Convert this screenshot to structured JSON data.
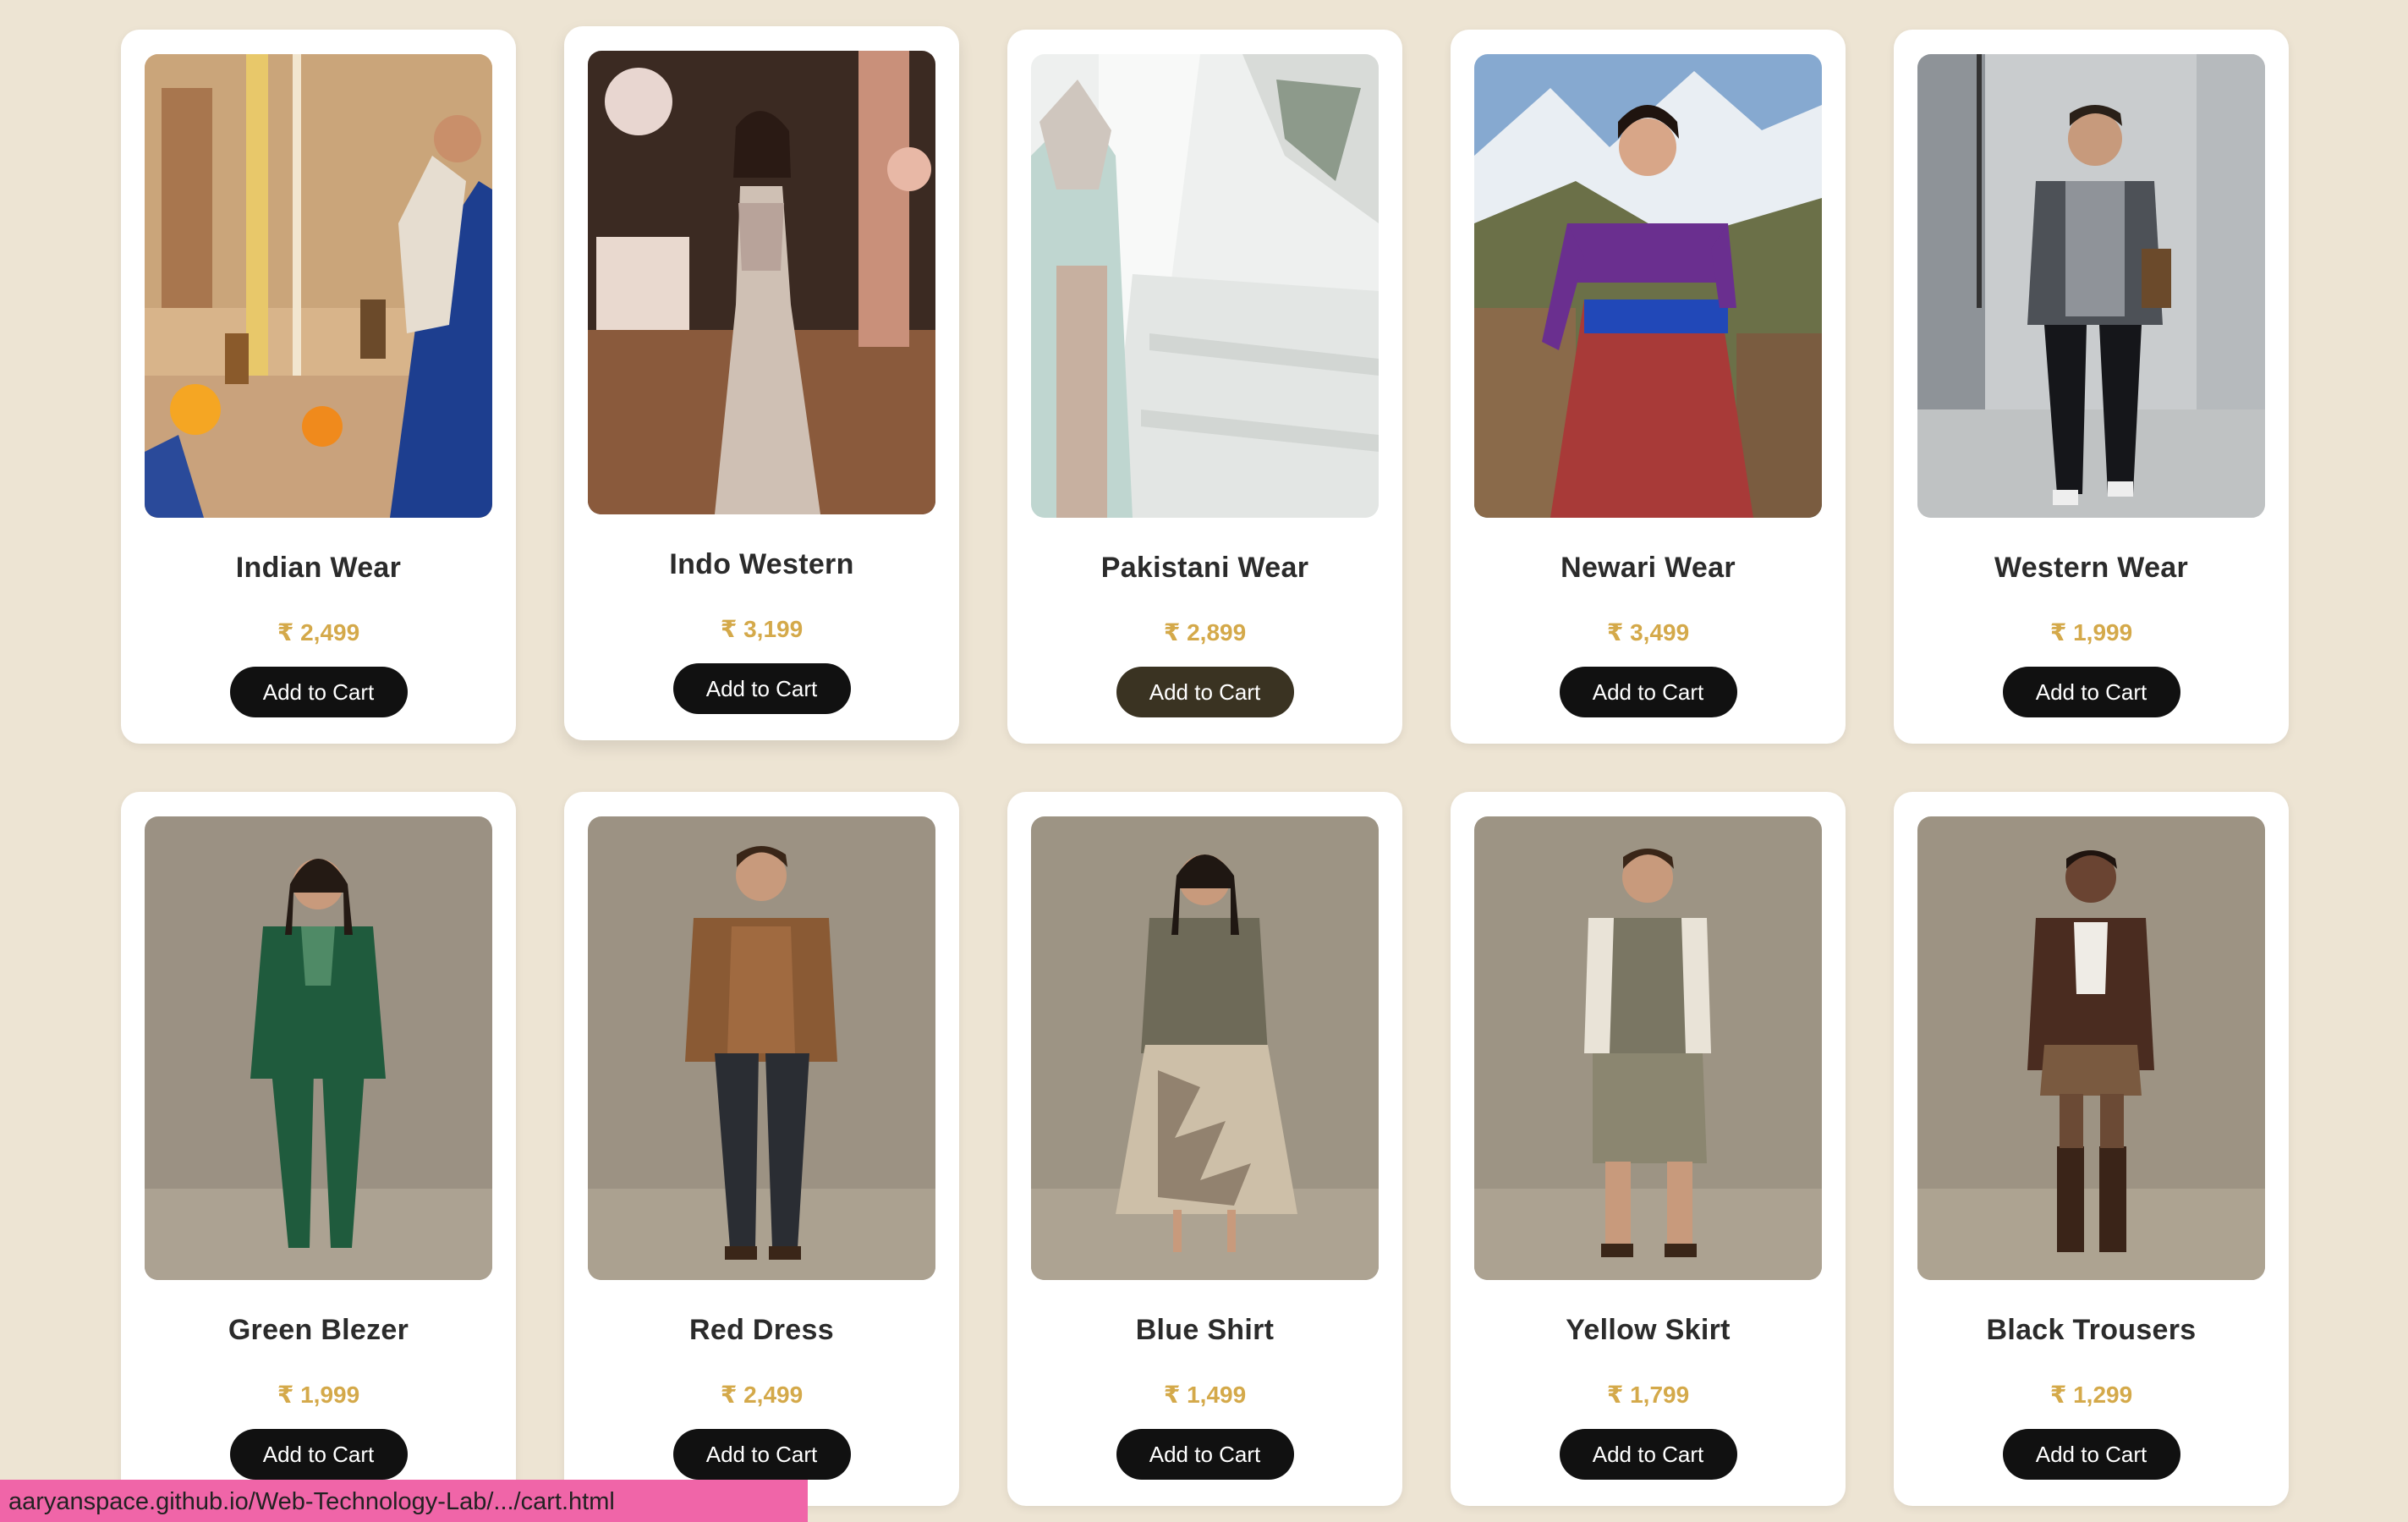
{
  "products": [
    {
      "name": "Indian Wear",
      "price": "₹ 2,499",
      "button": "Add to Cart",
      "image_icon": "indian-wear-photo-icon"
    },
    {
      "name": "Indo Western",
      "price": "₹ 3,199",
      "button": "Add to Cart",
      "image_icon": "indo-western-photo-icon"
    },
    {
      "name": "Pakistani Wear",
      "price": "₹ 2,899",
      "button": "Add to Cart",
      "image_icon": "pakistani-wear-photo-icon"
    },
    {
      "name": "Newari Wear",
      "price": "₹ 3,499",
      "button": "Add to Cart",
      "image_icon": "newari-wear-photo-icon"
    },
    {
      "name": "Western Wear",
      "price": "₹ 1,999",
      "button": "Add to Cart",
      "image_icon": "western-wear-photo-icon"
    },
    {
      "name": "Green Blezer",
      "price": "₹ 1,999",
      "button": "Add to Cart",
      "image_icon": "green-blezer-photo-icon"
    },
    {
      "name": "Red Dress",
      "price": "₹ 2,499",
      "button": "Add to Cart",
      "image_icon": "red-dress-photo-icon"
    },
    {
      "name": "Blue Shirt",
      "price": "₹ 1,499",
      "button": "Add to Cart",
      "image_icon": "blue-shirt-photo-icon"
    },
    {
      "name": "Yellow Skirt",
      "price": "₹ 1,799",
      "button": "Add to Cart",
      "image_icon": "yellow-skirt-photo-icon"
    },
    {
      "name": "Black Trousers",
      "price": "₹ 1,299",
      "button": "Add to Cart",
      "image_icon": "black-trousers-photo-icon"
    }
  ],
  "status_bar": {
    "url": "aaryanspace.github.io/Web-Technology-Lab/.../cart.html"
  },
  "colors": {
    "page_background": "#ede4d3",
    "card": "#ffffff",
    "price": "#d4a94a",
    "button": "#111111",
    "button_hover": "#3a3322",
    "status_bar": "#f065a8"
  }
}
